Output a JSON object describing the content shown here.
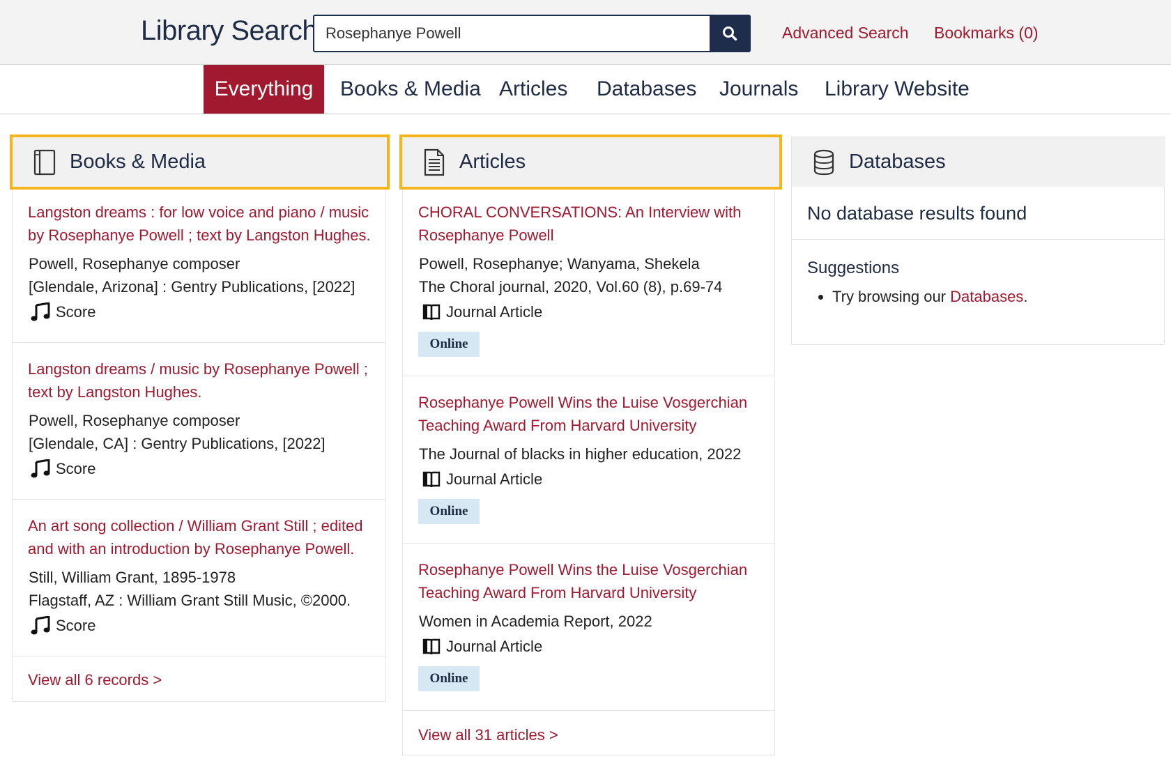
{
  "header": {
    "brand": "Library Search",
    "search_value": "Rosephanye Powell",
    "advanced_search": "Advanced Search",
    "bookmarks": "Bookmarks (0)"
  },
  "tabs": [
    {
      "label": "Everything",
      "active": true
    },
    {
      "label": "Books & Media",
      "active": false
    },
    {
      "label": "Articles",
      "active": false
    },
    {
      "label": "Databases",
      "active": false
    },
    {
      "label": "Journals",
      "active": false
    },
    {
      "label": "Library Website",
      "active": false
    }
  ],
  "books": {
    "title": "Books & Media",
    "icon": "book-icon",
    "items": [
      {
        "title": "Langston dreams : for low voice and piano / music by Rosephanye Powell ; text by Langston Hughes.",
        "author": "Powell, Rosephanye composer",
        "publisher": "[Glendale, Arizona] : Gentry Publications, [2022]",
        "format": "Score",
        "format_icon": "music-note-icon"
      },
      {
        "title": "Langston dreams / music by Rosephanye Powell ; text by Langston Hughes.",
        "author": "Powell, Rosephanye composer",
        "publisher": "[Glendale, CA] : Gentry Publications, [2022]",
        "format": "Score",
        "format_icon": "music-note-icon"
      },
      {
        "title": "An art song collection / William Grant Still ; edited and with an introduction by Rosephanye Powell.",
        "author": "Still, William Grant, 1895-1978",
        "publisher": "Flagstaff, AZ : William Grant Still Music, ©2000.",
        "format": "Score",
        "format_icon": "music-note-icon"
      }
    ],
    "view_all": "View all 6 records >"
  },
  "articles": {
    "title": "Articles",
    "icon": "document-icon",
    "items": [
      {
        "title": "CHORAL CONVERSATIONS: An Interview with Rosephanye Powell",
        "line1": "Powell, Rosephanye; Wanyama, Shekela",
        "line2": "The Choral journal, 2020, Vol.60 (8), p.69-74",
        "format": "Journal Article",
        "format_icon": "open-book-icon",
        "badge": "Online"
      },
      {
        "title": "Rosephanye Powell Wins the Luise Vosgerchian Teaching Award From Harvard University",
        "line1": "The Journal of blacks in higher education, 2022",
        "format": "Journal Article",
        "format_icon": "open-book-icon",
        "badge": "Online"
      },
      {
        "title": "Rosephanye Powell Wins the Luise Vosgerchian Teaching Award From Harvard University",
        "line1": "Women in Academia Report, 2022",
        "format": "Journal Article",
        "format_icon": "open-book-icon",
        "badge": "Online"
      }
    ],
    "view_all": "View all 31 articles >"
  },
  "databases": {
    "title": "Databases",
    "icon": "database-icon",
    "message": "No database results found",
    "suggestions_title": "Suggestions",
    "suggestion_prefix": "Try browsing our ",
    "suggestion_link": "Databases",
    "suggestion_suffix": "."
  },
  "colors": {
    "accent": "#a1192f",
    "navy": "#1f2d4d",
    "highlight": "#f4b41a",
    "badge_bg": "#d6e8f4"
  }
}
